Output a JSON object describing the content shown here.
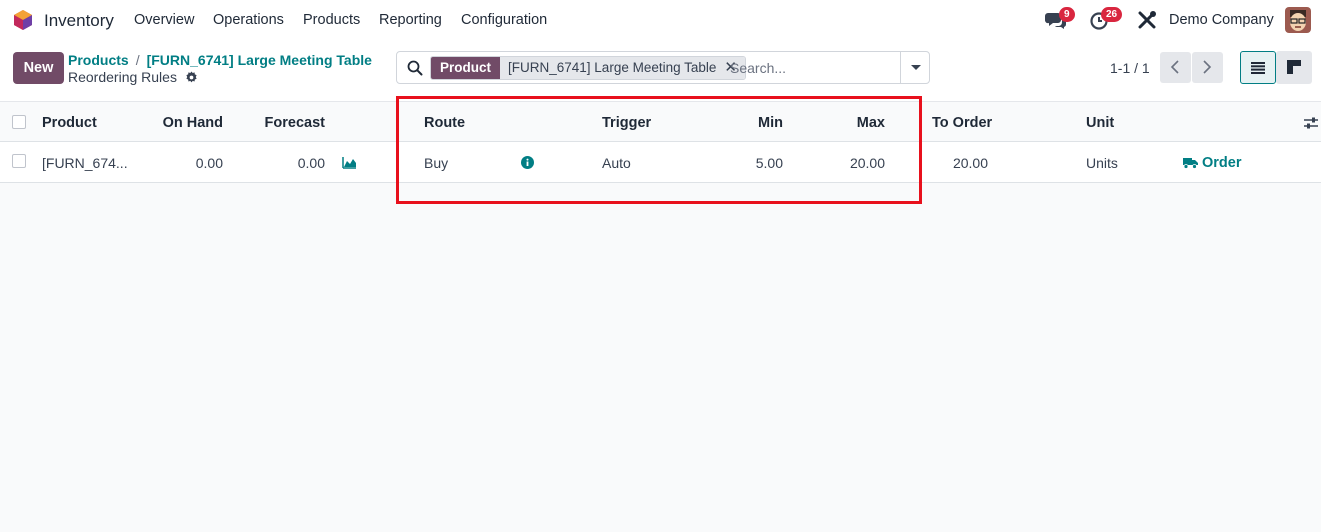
{
  "navbar": {
    "app_name": "Inventory",
    "menu": [
      "Overview",
      "Operations",
      "Products",
      "Reporting",
      "Configuration"
    ],
    "messages_badge": "9",
    "activities_badge": "26",
    "company": "Demo Company",
    "icons": [
      "inventory-logo-icon",
      "chat-icon",
      "clock-icon",
      "tools-icon",
      "avatar"
    ]
  },
  "control_panel": {
    "new_label": "New",
    "breadcrumb": [
      "Products",
      "[FURN_6741] Large Meeting Table"
    ],
    "current": "Reordering Rules",
    "search": {
      "facet_label": "Product",
      "facet_value": "[FURN_6741] Large Meeting Table",
      "placeholder": "Search..."
    },
    "pager": "1-1 / 1"
  },
  "table": {
    "columns": {
      "product": "Product",
      "on_hand": "On Hand",
      "forecast": "Forecast",
      "route": "Route",
      "trigger": "Trigger",
      "min": "Min",
      "max": "Max",
      "to_order": "To Order",
      "unit": "Unit"
    },
    "rows": [
      {
        "product": "[FURN_674...",
        "on_hand": "0.00",
        "forecast": "0.00",
        "route": "Buy",
        "trigger": "Auto",
        "min": "5.00",
        "max": "20.00",
        "to_order": "20.00",
        "unit": "Units",
        "action": "Order"
      }
    ]
  },
  "colors": {
    "brand": "#714b67",
    "accent": "#017e84",
    "badge": "#d9263f",
    "highlight": "#e8101c"
  }
}
